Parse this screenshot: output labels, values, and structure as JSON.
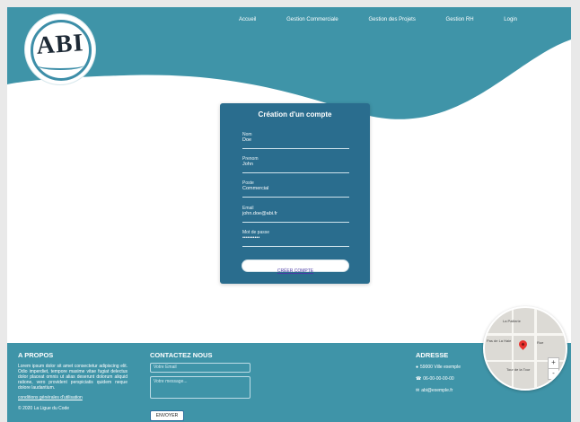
{
  "header": {
    "logo_text": "ABI",
    "nav": [
      "Accueil",
      "Gestion Commerciale",
      "Gestion des Projets",
      "Gestion RH",
      "Login"
    ]
  },
  "form": {
    "title": "Création d'un compte",
    "fields": [
      {
        "label": "Nom",
        "value": "Doe"
      },
      {
        "label": "Prenom",
        "value": "John"
      },
      {
        "label": "Poste",
        "value": "Commercial"
      },
      {
        "label": "Email",
        "value": "john.doe@abi.fr"
      },
      {
        "label": "Mot de passe",
        "value": "••••••••••"
      }
    ],
    "submit_label": "CRÉER COMPTE"
  },
  "footer": {
    "about_title": "A PROPOS",
    "about_text": "Lorem ipsum dolor sit amet consectetur adipiscing elit. Odio imperdiet, tempore maxime vitae fugiat delectus dolor placeat omnis ut alias deserunt dolorum aliquid ratione, vero provident perspiciatis quidem neque dolore laudantium.",
    "conditions_link": "conditions générales d'utilisation",
    "copyright": "© 2020 La Ligue du Code",
    "contact_title": "CONTACTEZ NOUS",
    "email_placeholder": "Votre Email",
    "message_placeholder": "Votre message...",
    "send_label": "ENVOYER",
    "address_title": "ADRESSE",
    "address_line": "59000 Ville exemple",
    "phone": "06-00-00-00-00",
    "email": "abi@exemple.fr"
  },
  "map": {
    "labels": [
      "La Paillerie",
      "Pas de La Haie",
      "Rue",
      "Tour de la Tour"
    ],
    "zoom_in": "+",
    "zoom_out": "-"
  },
  "colors": {
    "primary": "#3f94a8",
    "card": "#2a6d8e"
  }
}
